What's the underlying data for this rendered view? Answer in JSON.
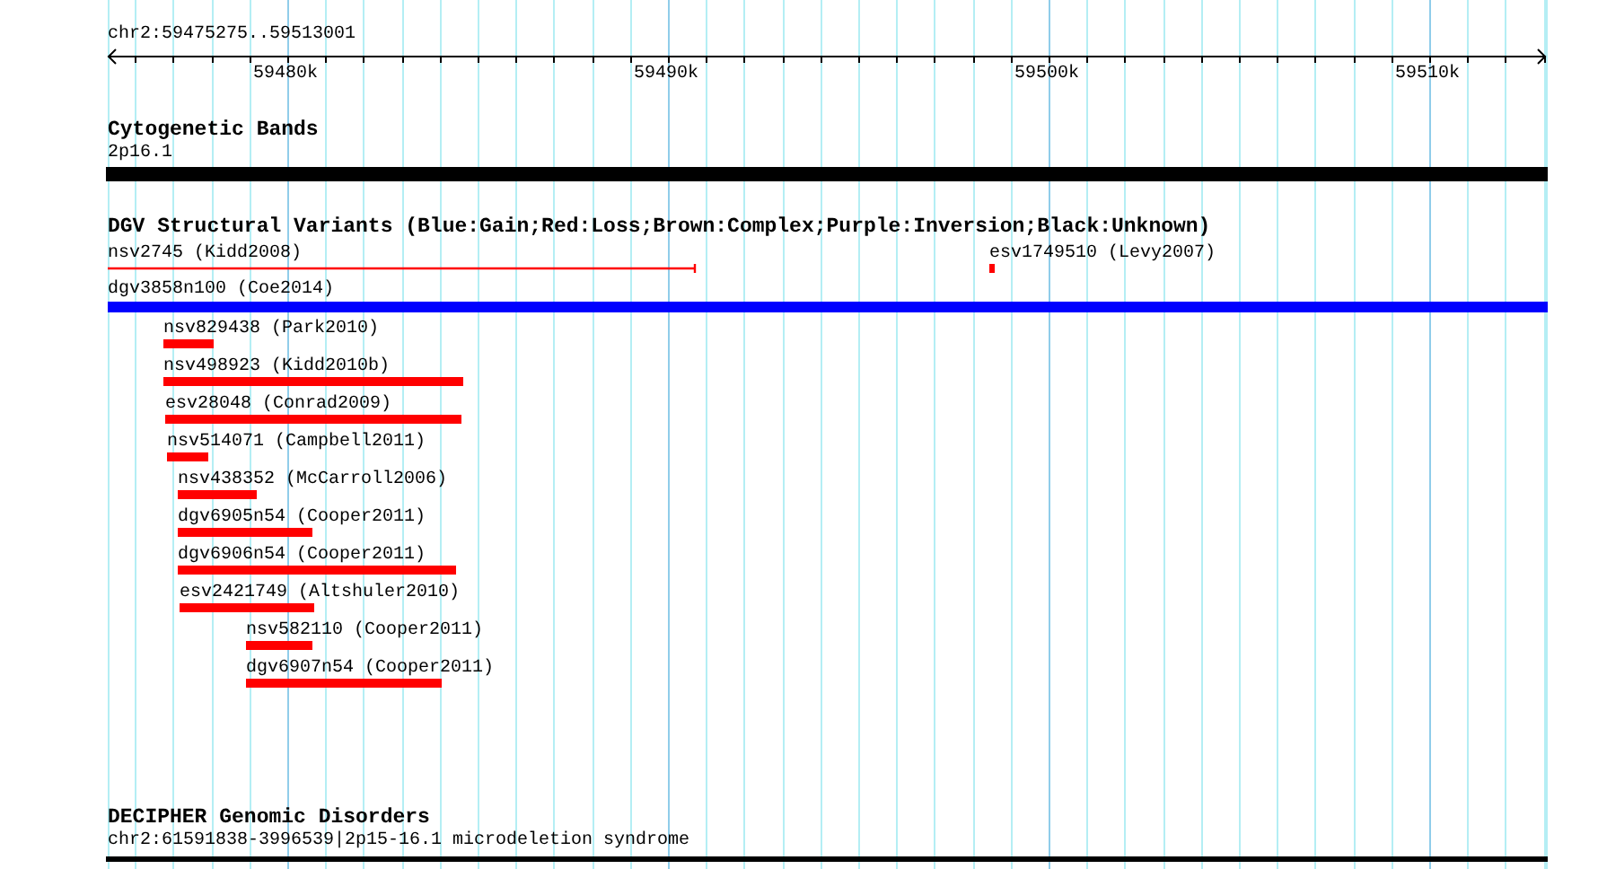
{
  "ruler": {
    "range": "chr2:59475275..59513001",
    "ticks": [
      "59480k",
      "59490k",
      "59500k",
      "59510k"
    ]
  },
  "tracks": [
    {
      "kind": "cytoband",
      "title": "Cytogenetic Bands",
      "features": [
        {
          "label": "2p16.1"
        }
      ]
    },
    {
      "kind": "variants",
      "title": "DGV Structural Variants (Blue:Gain;Red:Loss;Brown:Complex;Purple:Inversion;Black:Unknown)",
      "features": [
        {
          "label": "nsv2745 (Kidd2008)",
          "kind": "line",
          "color": "#ff0000"
        },
        {
          "label": "esv1749510 (Levy2007)",
          "kind": "bar",
          "color": "#ff0000"
        },
        {
          "label": "dgv3858n100 (Coe2014)",
          "kind": "bar",
          "color": "#0000ff"
        },
        {
          "label": "nsv829438 (Park2010)",
          "kind": "bar",
          "color": "#ff0000"
        },
        {
          "label": "nsv498923 (Kidd2010b)",
          "kind": "bar",
          "color": "#ff0000"
        },
        {
          "label": "esv28048 (Conrad2009)",
          "kind": "bar",
          "color": "#ff0000"
        },
        {
          "label": "nsv514071 (Campbell2011)",
          "kind": "bar",
          "color": "#ff0000"
        },
        {
          "label": "nsv438352 (McCarroll2006)",
          "kind": "bar",
          "color": "#ff0000"
        },
        {
          "label": "dgv6905n54 (Cooper2011)",
          "kind": "bar",
          "color": "#ff0000"
        },
        {
          "label": "dgv6906n54 (Cooper2011)",
          "kind": "bar",
          "color": "#ff0000"
        },
        {
          "label": "esv2421749 (Altshuler2010)",
          "kind": "bar",
          "color": "#ff0000"
        },
        {
          "label": "nsv582110 (Cooper2011)",
          "kind": "bar",
          "color": "#ff0000"
        },
        {
          "label": "dgv6907n54 (Cooper2011)",
          "kind": "bar",
          "color": "#ff0000"
        }
      ]
    },
    {
      "kind": "disorder",
      "title": "DECIPHER Genomic Disorders",
      "features": [
        {
          "label": "chr2:61591838-3996539|2p15-16.1 microdeletion syndrome"
        }
      ]
    }
  ]
}
